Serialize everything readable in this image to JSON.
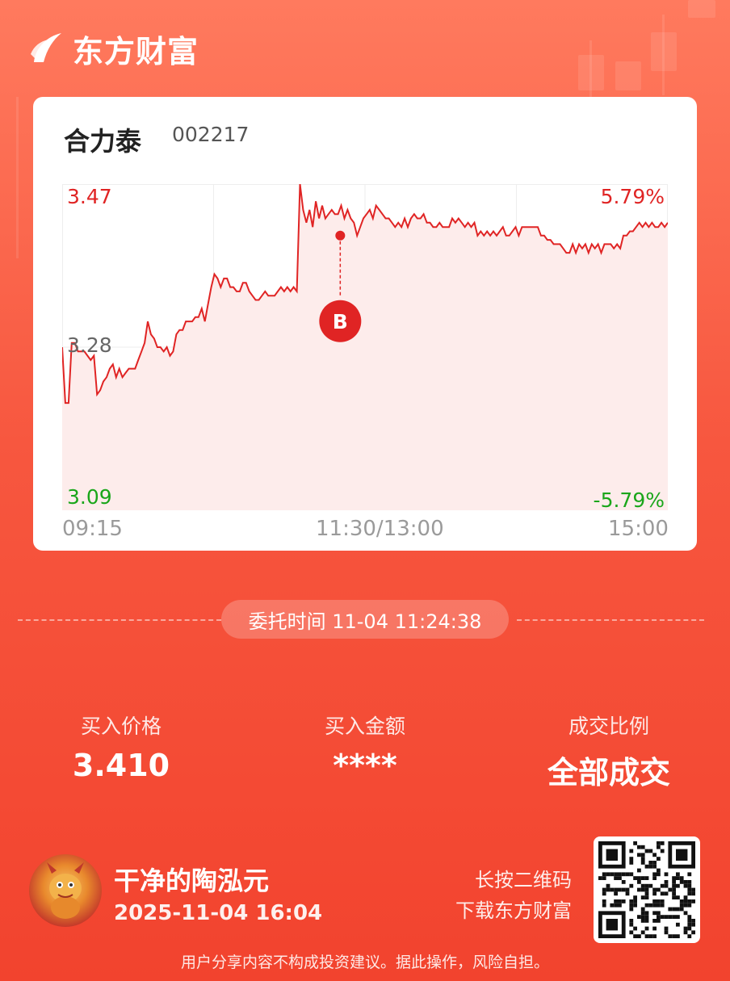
{
  "brand": {
    "name": "东方财富"
  },
  "stock": {
    "name": "合力泰",
    "code": "002217"
  },
  "chart_data": {
    "type": "line",
    "price_max_label": "3.47",
    "price_mid_label": "3.28",
    "price_min_label": "3.09",
    "pct_max_label": "5.79%",
    "pct_min_label": "-5.79%",
    "x_labels": [
      "09:15",
      "11:30/13:00",
      "15:00"
    ],
    "ylim": [
      3.09,
      3.47
    ],
    "prev_close": 3.28,
    "buy_marker": {
      "label": "B",
      "time": "11:24",
      "price": 3.41
    },
    "series": [
      {
        "values": [
          3.28,
          3.215,
          3.215,
          3.285,
          3.285,
          3.275,
          3.275,
          3.275,
          3.27,
          3.265,
          3.27,
          3.225,
          3.23,
          3.24,
          3.245,
          3.255,
          3.26,
          3.245,
          3.255,
          3.245,
          3.25,
          3.255,
          3.255,
          3.255,
          3.265,
          3.275,
          3.285,
          3.31,
          3.295,
          3.29,
          3.28,
          3.28,
          3.275,
          3.28,
          3.27,
          3.275,
          3.295,
          3.3,
          3.3,
          3.31,
          3.31,
          3.31,
          3.315,
          3.315,
          3.325,
          3.31,
          3.33,
          3.35,
          3.365,
          3.36,
          3.35,
          3.36,
          3.36,
          3.35,
          3.35,
          3.345,
          3.345,
          3.355,
          3.355,
          3.345,
          3.34,
          3.335,
          3.335,
          3.34,
          3.345,
          3.34,
          3.34,
          3.34,
          3.345,
          3.35,
          3.345,
          3.35,
          3.345,
          3.35,
          3.345,
          3.47,
          3.44,
          3.425,
          3.44,
          3.42,
          3.45,
          3.43,
          3.445,
          3.43,
          3.435,
          3.44,
          3.435,
          3.435,
          3.445,
          3.43,
          3.44,
          3.43,
          3.425,
          3.41,
          3.42,
          3.43,
          3.435,
          3.44,
          3.43,
          3.445,
          3.44,
          3.435,
          3.43,
          3.43,
          3.425,
          3.42,
          3.425,
          3.42,
          3.43,
          3.42,
          3.43,
          3.435,
          3.43,
          3.43,
          3.435,
          3.425,
          3.425,
          3.42,
          3.42,
          3.425,
          3.42,
          3.42,
          3.42,
          3.43,
          3.425,
          3.43,
          3.425,
          3.42,
          3.425,
          3.42,
          3.425,
          3.41,
          3.415,
          3.41,
          3.415,
          3.41,
          3.415,
          3.41,
          3.415,
          3.42,
          3.41,
          3.41,
          3.415,
          3.42,
          3.41,
          3.42,
          3.42,
          3.42,
          3.42,
          3.42,
          3.42,
          3.41,
          3.41,
          3.405,
          3.405,
          3.4,
          3.4,
          3.4,
          3.395,
          3.39,
          3.39,
          3.4,
          3.39,
          3.4,
          3.395,
          3.4,
          3.39,
          3.4,
          3.395,
          3.4,
          3.39,
          3.4,
          3.4,
          3.4,
          3.395,
          3.4,
          3.395,
          3.41,
          3.41,
          3.415,
          3.415,
          3.42,
          3.425,
          3.42,
          3.425,
          3.42,
          3.425,
          3.42,
          3.42,
          3.425,
          3.42,
          3.425
        ]
      }
    ]
  },
  "order": {
    "time_text": "委托时间 11-04 11:24:38"
  },
  "stats": [
    {
      "label": "买入价格",
      "value": "3.410"
    },
    {
      "label": "买入金额",
      "value": "****"
    },
    {
      "label": "成交比例",
      "value": "全部成交"
    }
  ],
  "user": {
    "name": "干净的陶泓元",
    "time": "2025-11-04 16:04"
  },
  "qr": {
    "line1": "长按二维码",
    "line2": "下载东方财富"
  },
  "disclaimer": "用户分享内容不构成投资建议。据此操作，风险自担。",
  "colors": {
    "up": "#e02424",
    "down": "#1aa61a",
    "mid": "#666666",
    "fill": "#fdeceb"
  }
}
